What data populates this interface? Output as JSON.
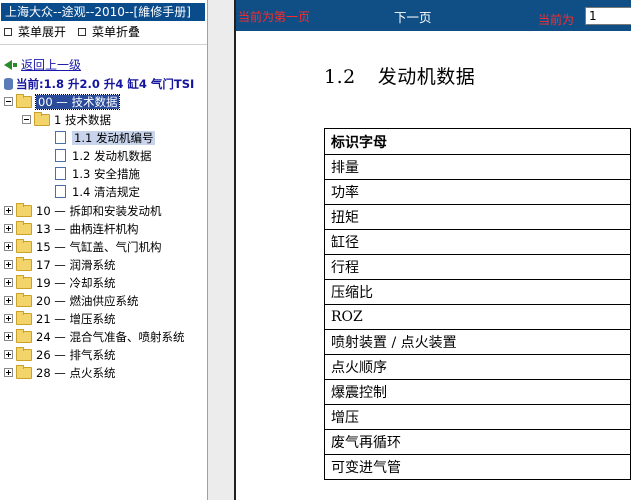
{
  "left_panel": {
    "title": "上海大众--途观--2010--[維修手册]",
    "menu": {
      "expand": "菜单展开",
      "collapse": "菜单折叠"
    },
    "back_link": "返回上一级",
    "current": "当前:1.8 升2.0 升4 缸4 气门TSI",
    "tree": {
      "root": "00 — 技术数据",
      "child": "1 技术数据",
      "leaves": [
        "1.1 发动机编号",
        "1.2 发动机数据",
        "1.3 安全措施",
        "1.4 清洁规定"
      ],
      "groups": [
        "10 — 拆卸和安装发动机",
        "13 — 曲柄连杆机构",
        "15 — 气缸盖、气门机构",
        "17 — 润滑系统",
        "19 — 冷却系统",
        "20 — 燃油供应系统",
        "21 — 增压系统",
        "24 — 混合气准备、喷射系统",
        "26 — 排气系统",
        "28 — 点火系统"
      ]
    }
  },
  "doc_toolbar": {
    "first_page": "当前为第一页",
    "next_page": "下一页",
    "current_label": "当前为",
    "page_value": "1"
  },
  "document": {
    "heading_number": "1.2",
    "heading_title": "发动机数据",
    "table_header": "标识字母",
    "rows": [
      "排量",
      "功率",
      "扭矩",
      "缸径",
      "行程",
      "压缩比",
      "ROZ",
      "喷射装置 / 点火装置",
      "点火顺序",
      "爆震控制",
      "增压",
      "废气再循环",
      "可变进气管"
    ]
  },
  "colors": {
    "title_bar": "#0a4b8c",
    "toolbar": "#0f4f86",
    "alert_text": "#ff2a2a",
    "link": "#1a1aa8"
  }
}
